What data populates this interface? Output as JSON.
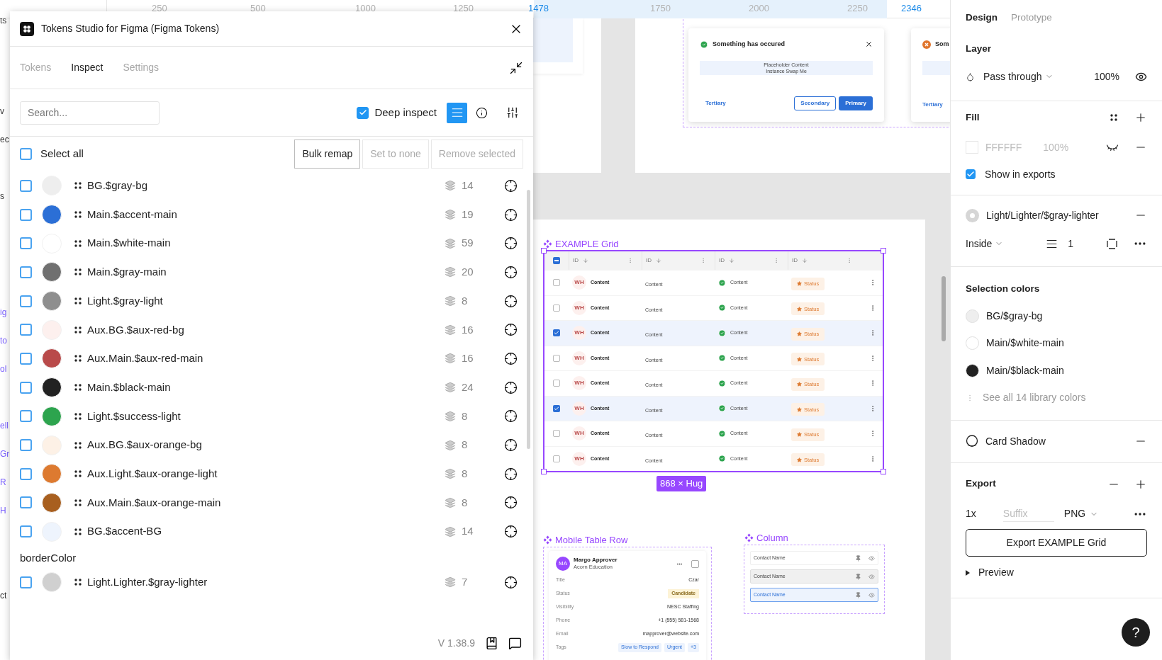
{
  "ruler": {
    "labels": [
      {
        "text": "250",
        "current": false
      },
      {
        "text": "500",
        "current": false
      },
      {
        "text": "1000",
        "current": false
      },
      {
        "text": "1250",
        "current": false
      },
      {
        "text": "1478",
        "current": true
      },
      {
        "text": "1750",
        "current": false
      },
      {
        "text": "2000",
        "current": false
      },
      {
        "text": "2250",
        "current": false
      },
      {
        "text": "2346",
        "current": true
      }
    ]
  },
  "layers_edge": [
    {
      "text": "ts",
      "kind": "plain"
    },
    {
      "text": "v",
      "kind": "plain"
    },
    {
      "text": "ec",
      "kind": "plain"
    },
    {
      "text": "s",
      "kind": "plain"
    },
    {
      "text": "ig",
      "kind": "component"
    },
    {
      "text": "to",
      "kind": "component"
    },
    {
      "text": "ol",
      "kind": "component"
    },
    {
      "text": "ell",
      "kind": "component"
    },
    {
      "text": "Gr",
      "kind": "component"
    },
    {
      "text": "R",
      "kind": "component"
    },
    {
      "text": "H",
      "kind": "component"
    },
    {
      "text": "ct",
      "kind": "plain"
    }
  ],
  "plugin": {
    "title": "Tokens Studio for Figma (Figma Tokens)",
    "tabs": [
      {
        "label": "Tokens",
        "selected": false
      },
      {
        "label": "Inspect",
        "selected": true
      },
      {
        "label": "Settings",
        "selected": false
      }
    ],
    "search": {
      "placeholder": "Search..."
    },
    "deep_inspect": {
      "label": "Deep inspect",
      "checked": true
    },
    "select_all": {
      "label": "Select all",
      "checked": false
    },
    "actions": [
      {
        "label": "Bulk remap",
        "disabled": false
      },
      {
        "label": "Set to none",
        "disabled": true
      },
      {
        "label": "Remove selected",
        "disabled": true
      }
    ],
    "groups": [
      {
        "tokens": [
          {
            "name": "BG.$gray-bg",
            "color": "#eeeeee",
            "count": "14",
            "checked": false
          },
          {
            "name": "Main.$accent-main",
            "color": "#2b6fd6",
            "count": "19",
            "checked": false
          },
          {
            "name": "Main.$white-main",
            "color": "#ffffff",
            "count": "59",
            "checked": false
          },
          {
            "name": "Main.$gray-main",
            "color": "#707070",
            "count": "20",
            "checked": false
          },
          {
            "name": "Light.$gray-light",
            "color": "#8e8e8e",
            "count": "8",
            "checked": false
          },
          {
            "name": "Aux.BG.$aux-red-bg",
            "color": "#fdf0ee",
            "count": "16",
            "checked": false
          },
          {
            "name": "Aux.Main.$aux-red-main",
            "color": "#b94a4a",
            "count": "16",
            "checked": false
          },
          {
            "name": "Main.$black-main",
            "color": "#222222",
            "count": "24",
            "checked": false
          },
          {
            "name": "Light.$success-light",
            "color": "#2da44e",
            "count": "8",
            "checked": false
          },
          {
            "name": "Aux.BG.$aux-orange-bg",
            "color": "#fdf1e6",
            "count": "8",
            "checked": false
          },
          {
            "name": "Aux.Light.$aux-orange-light",
            "color": "#dd7a30",
            "count": "8",
            "checked": false
          },
          {
            "name": "Aux.Main.$aux-orange-main",
            "color": "#a85f1f",
            "count": "8",
            "checked": false
          },
          {
            "name": "BG.$accent-BG",
            "color": "#eef4fd",
            "count": "14",
            "checked": false
          }
        ]
      },
      {
        "title": "borderColor",
        "tokens": [
          {
            "name": "Light.Lighter.$gray-lighter",
            "color": "#d0d0d0",
            "count": "7",
            "checked": false
          }
        ]
      }
    ],
    "version": "V 1.38.9"
  },
  "toast": {
    "title": "Something has occured",
    "body": [
      "Placeholder Content",
      "Instance Swap Me"
    ],
    "tertiary": "Tertiary",
    "secondary": "Secondary",
    "primary": "Primary"
  },
  "toast_2": {
    "title": "Som",
    "tertiary": "Tertiary"
  },
  "grid": {
    "title": "EXAMPLE Grid",
    "size": "868 × Hug",
    "header_indeterminate": true,
    "columns": [
      "ID",
      "ID",
      "ID",
      "ID"
    ],
    "rows": [
      {
        "selected": false,
        "avatar": "WH",
        "cells": [
          "Content",
          "Content",
          "Content"
        ],
        "status": "Status"
      },
      {
        "selected": false,
        "avatar": "WH",
        "cells": [
          "Content",
          "Content",
          "Content"
        ],
        "status": "Status"
      },
      {
        "selected": true,
        "avatar": "WH",
        "cells": [
          "Content",
          "Content",
          "Content"
        ],
        "status": "Status"
      },
      {
        "selected": false,
        "avatar": "WH",
        "cells": [
          "Content",
          "Content",
          "Content"
        ],
        "status": "Status"
      },
      {
        "selected": false,
        "avatar": "WH",
        "cells": [
          "Content",
          "Content",
          "Content"
        ],
        "status": "Status"
      },
      {
        "selected": true,
        "avatar": "WH",
        "cells": [
          "Content",
          "Content",
          "Content"
        ],
        "status": "Status"
      },
      {
        "selected": false,
        "avatar": "WH",
        "cells": [
          "Content",
          "Content",
          "Content"
        ],
        "status": "Status"
      },
      {
        "selected": false,
        "avatar": "WH",
        "cells": [
          "Content",
          "Content",
          "Content"
        ],
        "status": "Status"
      }
    ]
  },
  "mobile_row": {
    "title": "Mobile Table Row",
    "initials": "MA",
    "name": "Margo Approver",
    "org": "Acorn Education",
    "checked": false,
    "fields": [
      {
        "label": "Title",
        "kind": "text",
        "value": "Czar"
      },
      {
        "label": "Status",
        "kind": "badge",
        "value": "Candidate"
      },
      {
        "label": "Visibility",
        "kind": "text",
        "value": "NESC Staffing"
      },
      {
        "label": "Phone",
        "kind": "text",
        "value": "+1 (555) 581-1568"
      },
      {
        "label": "Email",
        "kind": "text",
        "value": "mapprover@website.com"
      }
    ],
    "tags_label": "Tags",
    "tags": [
      "Slow to Respond",
      "Urgent",
      "+3"
    ]
  },
  "column": {
    "title": "Column",
    "items": [
      {
        "label": "Contact Name",
        "kind": "default",
        "selected": false
      },
      {
        "label": "Contact Name",
        "kind": "hover",
        "selected": false
      },
      {
        "label": "Contact Name",
        "kind": "default",
        "selected": true
      }
    ]
  },
  "design_panel": {
    "tabs": [
      {
        "label": "Design",
        "selected": true
      },
      {
        "label": "Prototype",
        "selected": false
      }
    ],
    "layer": {
      "title": "Layer",
      "blend": "Pass through",
      "opacity": "100%"
    },
    "fill": {
      "title": "Fill",
      "hex": "FFFFFF",
      "opacity": "100%",
      "visible": false,
      "show_in_exports": {
        "label": "Show in exports",
        "checked": true
      }
    },
    "stroke": {
      "style": "Light/Lighter/$gray-lighter",
      "position": "Inside",
      "weight": "1"
    },
    "selection_colors": {
      "title": "Selection colors",
      "items": [
        {
          "name": "BG/$gray-bg",
          "color": "#eeeeee"
        },
        {
          "name": "Main/$white-main",
          "color": "#ffffff"
        },
        {
          "name": "Main/$black-main",
          "color": "#222222"
        }
      ],
      "see_all": "See all 14 library colors"
    },
    "effect": {
      "name": "Card Shadow"
    },
    "export": {
      "title": "Export",
      "scale": "1x",
      "suffix_placeholder": "Suffix",
      "format": "PNG",
      "button": "Export EXAMPLE Grid",
      "preview": "Preview"
    },
    "help": "?"
  }
}
